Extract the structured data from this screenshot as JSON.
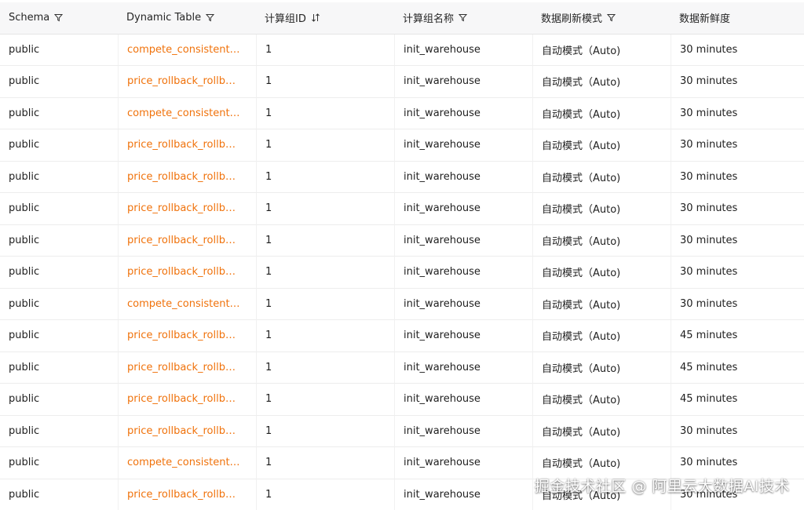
{
  "table": {
    "columns": [
      {
        "label": "Schema",
        "icon": "filter-icon"
      },
      {
        "label": "Dynamic Table",
        "icon": "filter-icon"
      },
      {
        "label": "计算组ID",
        "icon": "sort-icon"
      },
      {
        "label": "计算组名称",
        "icon": "filter-icon"
      },
      {
        "label": "数据刷新模式",
        "icon": "filter-icon"
      },
      {
        "label": "数据新鲜度",
        "icon": ""
      }
    ],
    "rows": [
      {
        "schema": "public",
        "table": "compete_consistent_pr...",
        "group_id": "1",
        "group_name": "init_warehouse",
        "mode": "自动模式（Auto)",
        "freshness": "30 minutes"
      },
      {
        "schema": "public",
        "table": "price_rollback_rollback_...",
        "group_id": "1",
        "group_name": "init_warehouse",
        "mode": "自动模式（Auto)",
        "freshness": "30 minutes"
      },
      {
        "schema": "public",
        "table": "compete_consistent_pr...",
        "group_id": "1",
        "group_name": "init_warehouse",
        "mode": "自动模式（Auto)",
        "freshness": "30 minutes"
      },
      {
        "schema": "public",
        "table": "price_rollback_rollback_...",
        "group_id": "1",
        "group_name": "init_warehouse",
        "mode": "自动模式（Auto)",
        "freshness": "30 minutes"
      },
      {
        "schema": "public",
        "table": "price_rollback_rollback_...",
        "group_id": "1",
        "group_name": "init_warehouse",
        "mode": "自动模式（Auto)",
        "freshness": "30 minutes"
      },
      {
        "schema": "public",
        "table": "price_rollback_rollback_...",
        "group_id": "1",
        "group_name": "init_warehouse",
        "mode": "自动模式（Auto)",
        "freshness": "30 minutes"
      },
      {
        "schema": "public",
        "table": "price_rollback_rollback_...",
        "group_id": "1",
        "group_name": "init_warehouse",
        "mode": "自动模式（Auto)",
        "freshness": "30 minutes"
      },
      {
        "schema": "public",
        "table": "price_rollback_rollback_...",
        "group_id": "1",
        "group_name": "init_warehouse",
        "mode": "自动模式（Auto)",
        "freshness": "30 minutes"
      },
      {
        "schema": "public",
        "table": "compete_consistent_pr...",
        "group_id": "1",
        "group_name": "init_warehouse",
        "mode": "自动模式（Auto)",
        "freshness": "30 minutes"
      },
      {
        "schema": "public",
        "table": "price_rollback_rollback_...",
        "group_id": "1",
        "group_name": "init_warehouse",
        "mode": "自动模式（Auto)",
        "freshness": "45 minutes"
      },
      {
        "schema": "public",
        "table": "price_rollback_rollback_...",
        "group_id": "1",
        "group_name": "init_warehouse",
        "mode": "自动模式（Auto)",
        "freshness": "45 minutes"
      },
      {
        "schema": "public",
        "table": "price_rollback_rollback_...",
        "group_id": "1",
        "group_name": "init_warehouse",
        "mode": "自动模式（Auto)",
        "freshness": "45 minutes"
      },
      {
        "schema": "public",
        "table": "price_rollback_rollback_...",
        "group_id": "1",
        "group_name": "init_warehouse",
        "mode": "自动模式（Auto)",
        "freshness": "30 minutes"
      },
      {
        "schema": "public",
        "table": "compete_consistent_pr...",
        "group_id": "1",
        "group_name": "init_warehouse",
        "mode": "自动模式（Auto)",
        "freshness": "30 minutes"
      },
      {
        "schema": "public",
        "table": "price_rollback_rollback_...",
        "group_id": "1",
        "group_name": "init_warehouse",
        "mode": "自动模式（Auto)",
        "freshness": "30 minutes"
      }
    ]
  },
  "watermark": "掘金技术社区 @ 阿里云大数据AI技术",
  "colors": {
    "link": "#f0720b",
    "header_bg": "#f7f7f8",
    "border": "#ededed"
  }
}
